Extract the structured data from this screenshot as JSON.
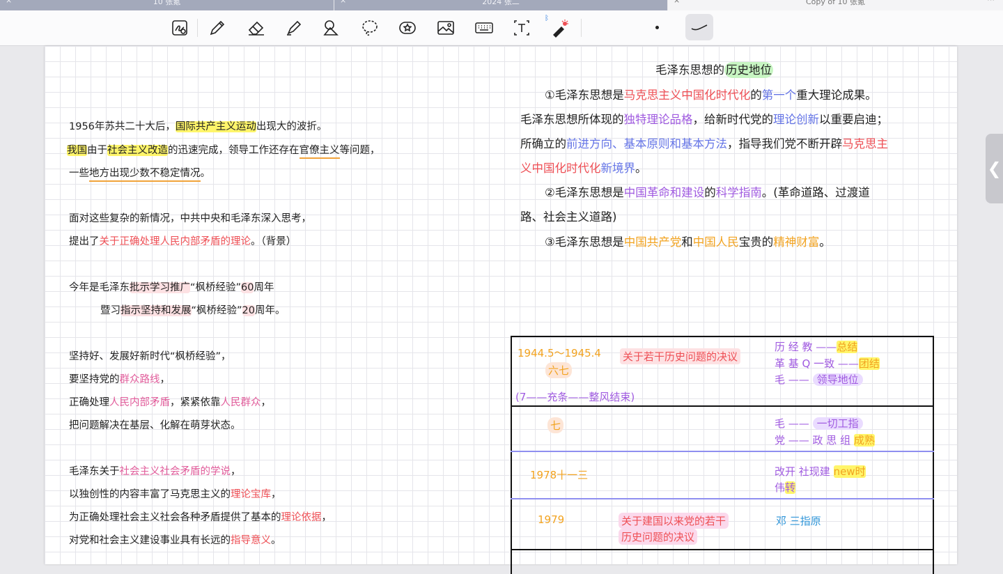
{
  "tabs": [
    {
      "label": "10 张氪",
      "close": "×"
    },
    {
      "label": "2024 张二",
      "close": "×"
    },
    {
      "label": "Copy of 10 张氪",
      "close": "×"
    }
  ],
  "tab_more": "⋯",
  "toolbar": {
    "tools": [
      "zoom-write-icon",
      "pen-icon",
      "eraser-icon",
      "highlighter-icon",
      "shapes-icon",
      "lasso-icon",
      "sticker-icon",
      "image-icon",
      "keyboard-icon",
      "text-box-icon",
      "laser-pointer-icon"
    ],
    "bluetooth": "bluetooth-icon"
  },
  "left_notes": {
    "p1_l1": {
      "a": "1956年苏共二十大后，",
      "b": "国际共产主义运动",
      "c": "出现大的波折。"
    },
    "p1_l2": {
      "a": "我国",
      "b": "由于",
      "c": "社会主义改造",
      "d": "的迅速完成，领导工作还存在",
      "e": "官僚主义",
      "f": "等问题，"
    },
    "p1_l3": {
      "a": "一些",
      "b": "地方出现少数不稳定情况",
      "c": "。"
    },
    "p2_l1": "面对这些复杂的新情况，中共中央和毛泽东深入思考，",
    "p2_l2": {
      "a": "提出了",
      "b": "关于正确处理人民内部矛盾的理论",
      "c": "。（背景）"
    },
    "p3_l1": {
      "a": "今年是毛泽东",
      "b": "批示学习推广",
      "c": "“枫桥经验”",
      "d": "60",
      "e": "周年"
    },
    "p3_l2": {
      "a": "暨习",
      "b": "指示坚持和发展",
      "c": "“枫桥经验”",
      "d": "20",
      "e": "周年。"
    },
    "p4_l1": "坚持好、发展好新时代“枫桥经验”，",
    "p4_l2": {
      "a": "要坚持党的",
      "b": "群众路线",
      "c": "，"
    },
    "p4_l3": {
      "a": "正确处理",
      "b": "人民内部矛盾",
      "c": "，紧紧依靠",
      "d": "人民群众",
      "e": "，"
    },
    "p4_l4": "把问题解决在基层、化解在萌芽状态。",
    "p5_l1": {
      "a": "毛泽东关于",
      "b": "社会主义社会矛盾的学说",
      "c": "，"
    },
    "p5_l2": {
      "a": "以独创性的内容丰富了马克思主义的",
      "b": "理论宝库",
      "c": "，"
    },
    "p5_l3": {
      "a": "为正确处理社会主义社会各种矛盾提供了基本的",
      "b": "理论依据",
      "c": "，"
    },
    "p5_l4": {
      "a": "对党和社会主义建设事业具有长远的",
      "b": "指导意义",
      "c": "。"
    }
  },
  "right_notes": {
    "title": {
      "a": "毛泽东思想的",
      "b": "历史地位"
    },
    "l1": {
      "a": "①毛泽东思想是",
      "b": "马克思主义中国化时代化",
      "c": "的",
      "d": "第一个",
      "e": "重大理论成果。"
    },
    "l2": {
      "a": "毛泽东思想所体现的",
      "b": "独特理论品格",
      "c": "，给新时代党的",
      "d": "理论创新",
      "e": "以重要启迪；"
    },
    "l3": {
      "a": "所确立的",
      "b": "前进方向、基本原则和基本方法",
      "c": "，指导我们党不断开辟",
      "d": "马克思主"
    },
    "l4": {
      "a": "义中国化时代化",
      "b": "新境界",
      "c": "。"
    },
    "l5": {
      "a": "②毛泽东思想是",
      "b": "中国革命和建设",
      "c": "的",
      "d": "科学指南",
      "e": "。(革命道路、过渡道"
    },
    "l6": "路、社会主义道路)",
    "l7": {
      "a": "③毛泽东思想是",
      "b": "中国共产党",
      "c": "和",
      "d": "中国人民",
      "e": "宝贵的",
      "f": "精神财富",
      "g": "。"
    }
  },
  "table": {
    "r1": {
      "date": "1944.5～1945.4",
      "session": "六七",
      "doc": "关于若干历史问题的决议",
      "note": "(7——充条——整风结束)",
      "m1": {
        "a": "历 经 教 ——",
        "b": "总结"
      },
      "m2": {
        "a": "革 基 Q 一致 ——",
        "b": "团结"
      },
      "m3": {
        "a": "毛 ——",
        "b": "领导地位"
      }
    },
    "r2": {
      "session": "七",
      "m1": {
        "a": "毛 ——",
        "b": "一切工指"
      },
      "m2": {
        "a": "党 —— 政 思 组",
        "b": "成熟"
      }
    },
    "r3": {
      "date": "1978十一三",
      "m1": {
        "a": "改开 社现建",
        "b": "new时"
      },
      "m2": {
        "a": "伟",
        "b": "转"
      }
    },
    "r4": {
      "date": "1979",
      "doc1": "关于建国以来党的若干",
      "doc2": "历史问题的决议",
      "m1": "邓 三指原"
    }
  },
  "side_handle": "❮",
  "colors": {
    "red": "#ee4f55",
    "pink": "#e15b9a",
    "violet": "#a05be0",
    "blue": "#6474e6",
    "orange": "#f2a320",
    "yellow_hl": "#fff56a"
  }
}
